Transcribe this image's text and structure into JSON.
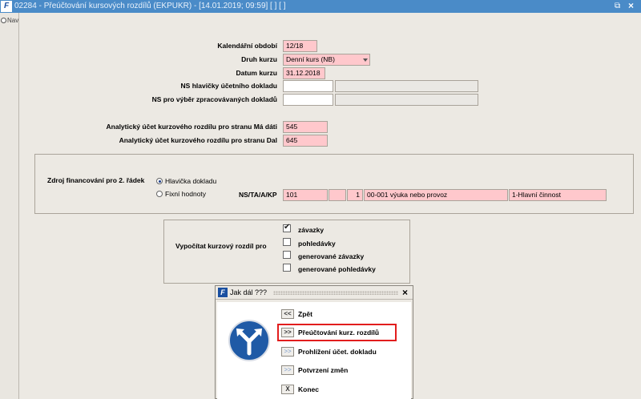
{
  "window": {
    "title": "02284 - Přeúčtování kursových rozdílů (EKPUKR) - [14.01.2019; 09:59]  [ ]  [ ]",
    "logo_text": "F"
  },
  "nav": {
    "tab_label": "Nav"
  },
  "form": {
    "period": {
      "label": "Kalendářní období",
      "value": "12/18"
    },
    "rate_type": {
      "label": "Druh kurzu",
      "value": "Denní kurs (NB)"
    },
    "rate_date": {
      "label": "Datum kurzu",
      "value": "31.12.2018"
    },
    "ns_header": {
      "label": "NS hlavičky účetního dokladu",
      "value": "",
      "desc": ""
    },
    "ns_select": {
      "label": "NS pro výběr zpracovávaných dokladů",
      "value": "",
      "desc": ""
    },
    "acct_md": {
      "label": "Analytický účet kurzového rozdílu pro stranu Má dáti",
      "value": "545"
    },
    "acct_dal": {
      "label": "Analytický účet kurzového rozdílu pro stranu Dal",
      "value": "645"
    }
  },
  "funding": {
    "label": "Zdroj financování pro 2. řádek",
    "option_header": "Hlavička dokladu",
    "option_fixed": "Fixní hodnoty",
    "selected": "option_header",
    "ns_label": "NS/TA/A/KP",
    "ns": "101",
    "ta": "",
    "a": "1",
    "kp": "00-001 výuka nebo provoz",
    "activity": "1-Hlavní činnost"
  },
  "calc": {
    "label": "Vypočítat kurzový rozdíl pro",
    "items": [
      {
        "label": "závazky",
        "checked": true
      },
      {
        "label": "pohledávky",
        "checked": false
      },
      {
        "label": "generované závazky",
        "checked": false
      },
      {
        "label": "generované pohledávky",
        "checked": false
      }
    ]
  },
  "dialog": {
    "title": "Jak dál ???",
    "logo_text": "F",
    "sign_icon": "turn-left-or-right-sign-icon",
    "buttons": [
      {
        "glyph": "<<",
        "label": "Zpět",
        "dim": false
      },
      {
        "glyph": ">>",
        "label": "Přeúčtování kurz. rozdílů",
        "dim": false,
        "highlight": true
      },
      {
        "glyph": ">>",
        "label": "Prohlížení účet. dokladu",
        "dim": true
      },
      {
        "glyph": ">>",
        "label": "Potvrzení změn",
        "dim": true
      },
      {
        "glyph": "X",
        "label": "Konec",
        "dim": false
      }
    ],
    "highlight_color": "#e21d1d"
  },
  "colors": {
    "titlebar": "#4a8bc8",
    "required_field": "#ffc8cc",
    "background": "#ece9e3"
  }
}
